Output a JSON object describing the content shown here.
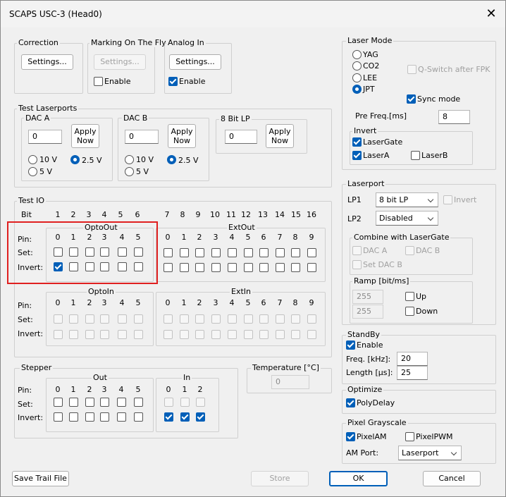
{
  "window": {
    "title": "SCAPS USC-3 (Head0)",
    "close": "✕"
  },
  "correction": {
    "title": "Correction",
    "settings": "Settings..."
  },
  "marking": {
    "title": "Marking On The Fly",
    "settings": "Settings...",
    "enable": "Enable"
  },
  "analog": {
    "title": "Analog In",
    "settings": "Settings...",
    "enable": "Enable"
  },
  "test_laserports": {
    "title": "Test Laserports",
    "dac_a": {
      "title": "DAC A",
      "value": "0",
      "apply": [
        "Apply",
        "Now"
      ],
      "r10": "10 V",
      "r25": "2.5 V",
      "r5": "5 V"
    },
    "dac_b": {
      "title": "DAC B",
      "value": "0",
      "apply": [
        "Apply",
        "Now"
      ],
      "r10": "10 V",
      "r25": "2.5 V",
      "r5": "5 V"
    },
    "lp8": {
      "title": "8 Bit LP",
      "value": "0",
      "apply": [
        "Apply",
        "Now"
      ]
    }
  },
  "test_io": {
    "title": "Test IO",
    "bit_label": "Bit",
    "bits": [
      "1",
      "2",
      "3",
      "4",
      "5",
      "6",
      "7",
      "8",
      "9",
      "10",
      "11",
      "12",
      "13",
      "14",
      "15",
      "16"
    ],
    "row_pin": "Pin:",
    "row_set": "Set:",
    "row_invert": "Invert:",
    "optoout": {
      "title": "OptoOut",
      "pins": [
        "0",
        "1",
        "2",
        "3",
        "4",
        "5"
      ]
    },
    "extout": {
      "title": "ExtOut",
      "pins": [
        "0",
        "1",
        "2",
        "3",
        "4",
        "5",
        "6",
        "7",
        "8",
        "9"
      ]
    },
    "optoin": {
      "title": "OptoIn",
      "pins": [
        "0",
        "1",
        "2",
        "3",
        "4",
        "5"
      ]
    },
    "extin": {
      "title": "ExtIn",
      "pins": [
        "0",
        "1",
        "2",
        "3",
        "4",
        "5",
        "6",
        "7",
        "8",
        "9"
      ]
    }
  },
  "stepper": {
    "title": "Stepper",
    "out": {
      "title": "Out",
      "pins": [
        "0",
        "1",
        "2",
        "3",
        "4",
        "5"
      ]
    },
    "in": {
      "title": "In",
      "pins": [
        "0",
        "1",
        "2"
      ]
    }
  },
  "temperature": {
    "title": "Temperature [°C]",
    "value": "0"
  },
  "laser_mode": {
    "title": "Laser Mode",
    "modes": [
      "YAG",
      "CO2",
      "LEE",
      "JPT"
    ],
    "qswitch": "Q-Switch after FPK",
    "sync": "Sync mode",
    "prefreq_label": "Pre Freq.[ms]",
    "prefreq_value": "8",
    "invert": {
      "title": "Invert",
      "lasergate": "LaserGate",
      "lasera": "LaserA",
      "laserb": "LaserB"
    }
  },
  "laserport": {
    "title": "Laserport",
    "lp1_label": "LP1",
    "lp1_value": "8 bit LP",
    "invert": "Invert",
    "lp2_label": "LP2",
    "lp2_value": "Disabled",
    "combine": {
      "title": "Combine with LaserGate",
      "daca": "DAC A",
      "dacb": "DAC B",
      "setdacb": "Set DAC B"
    },
    "ramp": {
      "title": "Ramp [bit/ms]",
      "v1": "255",
      "v2": "255",
      "up": "Up",
      "down": "Down"
    }
  },
  "standby": {
    "title": "StandBy",
    "enable": "Enable",
    "freq_label": "Freq. [kHz]:",
    "freq_value": "20",
    "len_label": "Length [µs]:",
    "len_value": "25"
  },
  "optimize": {
    "title": "Optimize",
    "polydelay": "PolyDelay"
  },
  "pixel": {
    "title": "Pixel Grayscale",
    "pixelam": "PixelAM",
    "pixelpwm": "PixelPWM",
    "amport_label": "AM Port:",
    "amport_value": "Laserport"
  },
  "footer": {
    "save": "Save Trail File",
    "store": "Store",
    "ok": "OK",
    "cancel": "Cancel"
  }
}
